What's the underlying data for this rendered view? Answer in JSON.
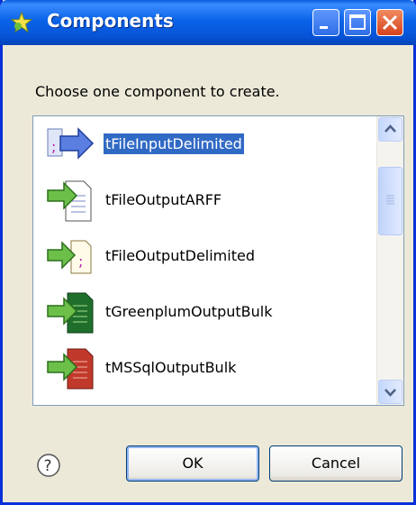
{
  "window": {
    "title": "Components"
  },
  "dialog": {
    "prompt": "Choose one component to create."
  },
  "components": [
    {
      "label": "tFileInputDelimited",
      "selected": true,
      "icon": "file-input-delimited-icon"
    },
    {
      "label": "tFileOutputARFF",
      "selected": false,
      "icon": "file-output-arff-icon"
    },
    {
      "label": "tFileOutputDelimited",
      "selected": false,
      "icon": "file-output-delimited-icon"
    },
    {
      "label": "tGreenplumOutputBulk",
      "selected": false,
      "icon": "greenplum-output-bulk-icon"
    },
    {
      "label": "tMSSqlOutputBulk",
      "selected": false,
      "icon": "mssql-output-bulk-icon"
    }
  ],
  "buttons": {
    "ok": "OK",
    "cancel": "Cancel"
  },
  "colors": {
    "selection": "#316ac5",
    "titlebar": "#0a5fe0",
    "dialog_bg": "#ece9d8"
  }
}
